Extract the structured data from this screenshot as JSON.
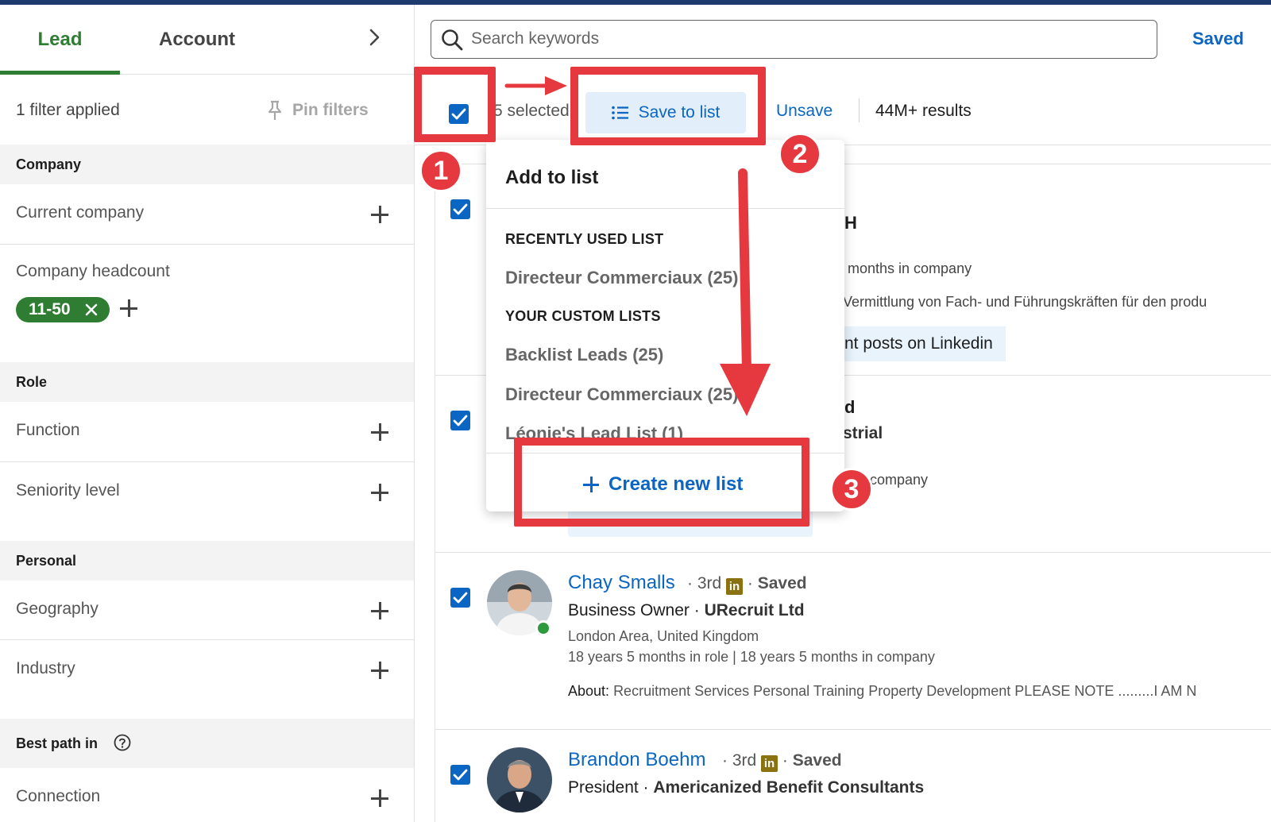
{
  "left": {
    "tabs": {
      "lead": "Lead",
      "account": "Account"
    },
    "filter_count": "1 filter applied",
    "pin_filters": "Pin filters",
    "sections": {
      "company": "Company",
      "role": "Role",
      "personal": "Personal",
      "best_path": "Best path in"
    },
    "filters": {
      "current_company": "Current company",
      "company_headcount": "Company headcount",
      "headcount_pill": "11-50",
      "function": "Function",
      "seniority": "Seniority level",
      "geography": "Geography",
      "industry": "Industry",
      "connection": "Connection"
    }
  },
  "search": {
    "placeholder": "Search keywords",
    "saved_link": "Saved"
  },
  "actionbar": {
    "selected": "5 selected",
    "save_to_list": "Save to list",
    "unsave": "Unsave",
    "results": "44M+ results"
  },
  "dropdown": {
    "title": "Add to list",
    "recent_heading": "RECENTLY USED LIST",
    "recent_items": [
      "Directeur Commerciaux (25)"
    ],
    "custom_heading": "YOUR CUSTOM LISTS",
    "custom_items": [
      "Backlist Leads (25)",
      "Directeur Commerciaux (25)",
      "Léonie's Lead List (1)"
    ],
    "create": "Create new list"
  },
  "card_fragments": {
    "c1_name_tail": "H",
    "c1_tenure_tail": "months in company",
    "c1_about_tail": "Vermittlung von Fach- und Führungskräften für den produ",
    "c1_chip_tail": "nt posts on Linkedin",
    "c2_name_tail": "d",
    "c2_company_tail": "strial",
    "c2_tenure_tail": "company"
  },
  "leads": [
    {
      "name": "Chay Smalls",
      "degree": "3rd",
      "saved": "Saved",
      "role": "Business Owner",
      "company": "URecruit Ltd",
      "location": "London Area, United Kingdom",
      "tenure": "18 years 5 months in role | 18 years 5 months in company",
      "about_label": "About:",
      "about": "Recruitment Services Personal Training Property Development PLEASE NOTE .........I AM N"
    },
    {
      "name": "Brandon Boehm",
      "degree": "3rd",
      "saved": "Saved",
      "role": "President",
      "company": "Americanized Benefit Consultants"
    }
  ],
  "annotations": {
    "m1": "1",
    "m2": "2",
    "m3": "3"
  },
  "colors": {
    "linkedin_blue": "#0a66c2",
    "green": "#2e7d32",
    "annotation_red": "#e5393f"
  }
}
